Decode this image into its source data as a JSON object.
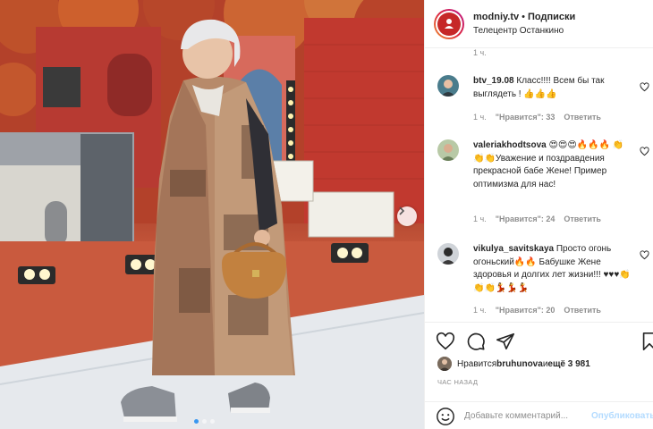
{
  "post": {
    "username": "modniy.tv",
    "separator": "•",
    "follow_label": "Подписки",
    "location": "Телецентр Останкино",
    "top_time": "1 ч."
  },
  "comments": [
    {
      "username": "btv_19.08",
      "text": " Класс!!!! Всем бы так выглядеть ! 👍👍👍",
      "time": "1 ч.",
      "likes": "\"Нравится\": 33",
      "reply": "Ответить"
    },
    {
      "username": "valeriakhodtsova",
      "text": " 😍😍😍🔥🔥🔥 👏👏👏Уважение и поздравдения прекрасной бабе Жене! Пример оптимизма для нас!",
      "time": "1 ч.",
      "likes": "\"Нравится\": 24",
      "reply": "Ответить"
    },
    {
      "username": "vikulya_savitskaya",
      "text": " Просто огонь огоньский🔥🔥 Бабушке Жене здоровья и долгих лет жизни!!! ♥♥♥👏👏👏💃💃💃",
      "time": "1 ч.",
      "likes": "\"Нравится\": 20",
      "reply": "Ответить"
    }
  ],
  "likes_line": {
    "prefix": "Нравится ",
    "user": "bruhunova",
    "middle": " и ",
    "rest": "ещё 3 981"
  },
  "timeago": "ЧАС НАЗАД",
  "add_comment": {
    "placeholder": "Добавьте комментарий...",
    "publish_label": "Опубликовать"
  },
  "icons": {
    "like": "heart-icon",
    "comment": "comment-icon",
    "share": "share-icon",
    "save": "bookmark-icon",
    "emoji": "smile-icon",
    "next": "chevron-right-icon"
  },
  "colors": {
    "accent": "#3897f0",
    "publish_disabled": "#b3dbff",
    "meta_gray": "#8e8e8e"
  }
}
